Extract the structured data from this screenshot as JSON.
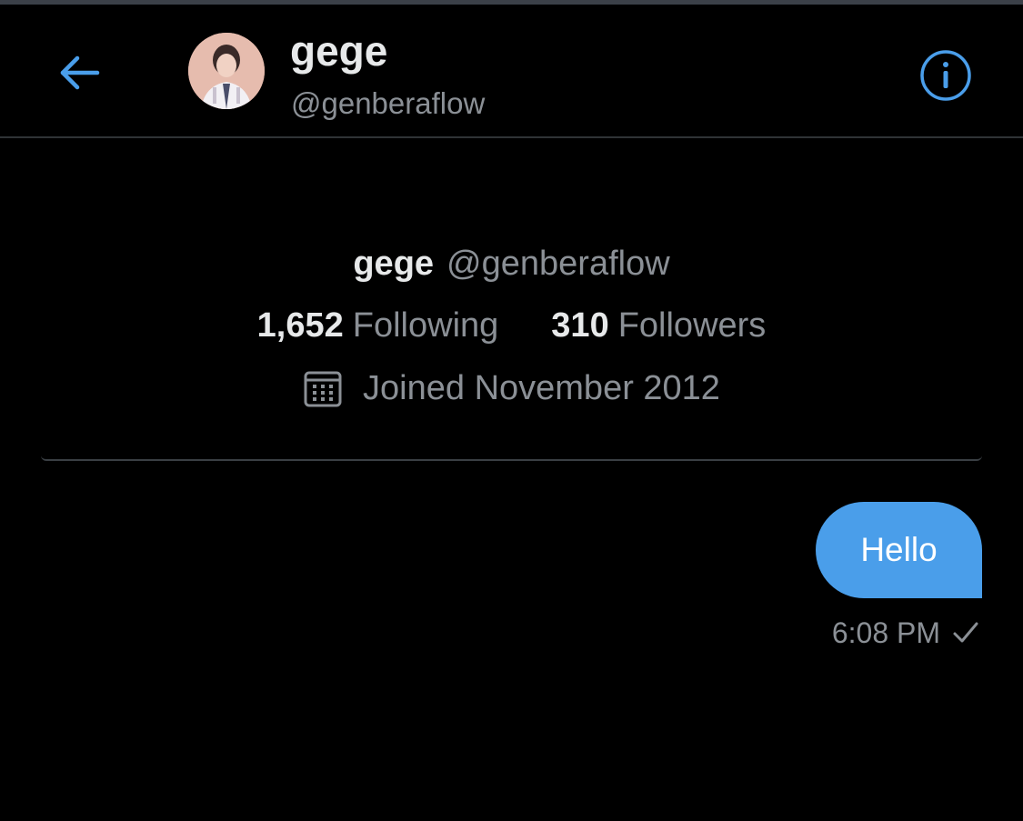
{
  "header": {
    "name": "gege",
    "handle": "@genberaflow",
    "back_icon": "arrow-left-icon",
    "info_icon": "info-circle-icon",
    "accent_color": "#4a9eea"
  },
  "profile_card": {
    "name": "gege",
    "handle": "@genberaflow",
    "following_count": "1,652",
    "following_label": "Following",
    "followers_count": "310",
    "followers_label": "Followers",
    "calendar_icon": "calendar-icon",
    "joined_text": "Joined November 2012"
  },
  "messages": [
    {
      "text": "Hello",
      "time": "6:08 PM",
      "status_icon": "checkmark-icon",
      "bubble_color": "#4a9eea"
    }
  ]
}
